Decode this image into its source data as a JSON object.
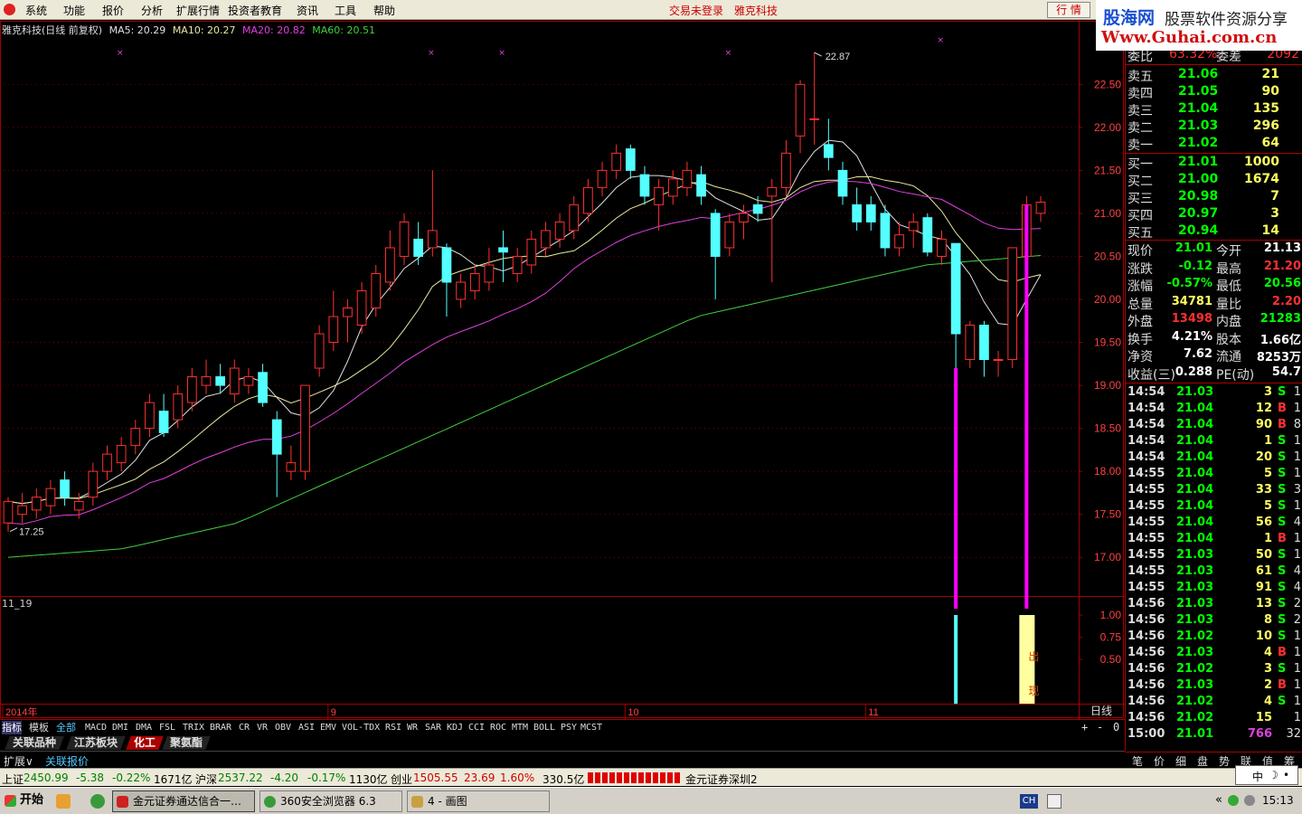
{
  "menubar": {
    "items": [
      "系统",
      "功能",
      "报价",
      "分析",
      "扩展行情",
      "投资者教育",
      "资讯",
      "工具",
      "帮助"
    ],
    "not_logged": "交易未登录",
    "stock_name": "雅克科技",
    "hq_button": "行 情"
  },
  "watermark": {
    "site_cn": "股海网",
    "slogan": "股票软件资源分享",
    "url": "Www.Guhai.com.cn"
  },
  "chart": {
    "title": "雅克科技(日线 前复权)",
    "ma_legend": [
      {
        "label": "MA5: 20.29",
        "color": "#e0e0e0"
      },
      {
        "label": "MA10: 20.27",
        "color": "#e8e8a0"
      },
      {
        "label": "MA20: 20.82",
        "color": "#e040e0"
      },
      {
        "label": "MA60: 20.51",
        "color": "#40d040"
      }
    ],
    "high_label": "22.87",
    "low_label": "17.25",
    "indicator_name": "11_19",
    "signal_text": [
      "出",
      "现"
    ],
    "period": "日线",
    "colors": {
      "up": "#ff3030",
      "down": "#54ffff",
      "ma5": "#e0e0e0",
      "ma10": "#e8e8a0",
      "ma20": "#e040e0",
      "ma60": "#40d040",
      "signal": "#ff00ff",
      "grid": "#a00000",
      "highlight": "#ffffa0"
    }
  },
  "chart_data": {
    "type": "candlestick",
    "price_axis": [
      "22.50",
      "22.00",
      "21.50",
      "21.00",
      "20.50",
      "20.00",
      "19.50",
      "19.00",
      "18.50",
      "18.00",
      "17.50",
      "17.00"
    ],
    "ind_axis": [
      "1.00",
      "0.75",
      "0.50"
    ],
    "date_axis": [
      {
        "label": "2014年",
        "i": 0
      },
      {
        "label": "9",
        "i": 23
      },
      {
        "label": "10",
        "i": 44
      },
      {
        "label": "11",
        "i": 61
      }
    ],
    "candles": [
      [
        17.4,
        17.65,
        17.3,
        17.7
      ],
      [
        17.5,
        17.6,
        17.4,
        17.75
      ],
      [
        17.55,
        17.7,
        17.45,
        17.8
      ],
      [
        17.6,
        17.8,
        17.5,
        17.9
      ],
      [
        17.9,
        17.7,
        17.6,
        18.0
      ],
      [
        17.55,
        17.65,
        17.45,
        17.75
      ],
      [
        17.7,
        18.0,
        17.6,
        18.1
      ],
      [
        18.0,
        18.2,
        17.9,
        18.3
      ],
      [
        18.1,
        18.3,
        18.0,
        18.4
      ],
      [
        18.3,
        18.5,
        18.2,
        18.6
      ],
      [
        18.5,
        18.8,
        18.4,
        18.9
      ],
      [
        18.7,
        18.45,
        18.4,
        18.9
      ],
      [
        18.6,
        18.9,
        18.5,
        19.0
      ],
      [
        18.8,
        19.1,
        18.7,
        19.2
      ],
      [
        19.0,
        19.1,
        18.9,
        19.3
      ],
      [
        19.1,
        19.0,
        18.9,
        19.25
      ],
      [
        18.9,
        19.2,
        18.8,
        19.3
      ],
      [
        19.0,
        19.1,
        18.9,
        19.2
      ],
      [
        19.15,
        18.8,
        18.75,
        19.25
      ],
      [
        18.6,
        18.2,
        17.7,
        18.7
      ],
      [
        18.0,
        18.1,
        17.9,
        18.3
      ],
      [
        18.0,
        19.0,
        17.9,
        19.0
      ],
      [
        19.2,
        19.6,
        19.1,
        19.7
      ],
      [
        19.5,
        19.8,
        19.4,
        20.1
      ],
      [
        19.8,
        19.9,
        19.5,
        20.0
      ],
      [
        19.7,
        20.1,
        19.6,
        20.2
      ],
      [
        19.9,
        20.3,
        19.8,
        20.4
      ],
      [
        20.2,
        20.6,
        20.1,
        20.8
      ],
      [
        20.5,
        20.9,
        20.4,
        21.0
      ],
      [
        20.7,
        20.5,
        20.4,
        20.9
      ],
      [
        20.6,
        20.8,
        20.5,
        21.5
      ],
      [
        20.6,
        20.2,
        19.8,
        20.65
      ],
      [
        20.0,
        20.2,
        19.9,
        20.3
      ],
      [
        20.1,
        20.3,
        20.0,
        20.4
      ],
      [
        20.2,
        20.4,
        20.1,
        20.6
      ],
      [
        20.6,
        20.55,
        20.2,
        20.8
      ],
      [
        20.3,
        20.5,
        20.2,
        20.6
      ],
      [
        20.4,
        20.7,
        20.3,
        20.8
      ],
      [
        20.6,
        20.8,
        20.5,
        20.9
      ],
      [
        20.7,
        20.9,
        20.6,
        21.0
      ],
      [
        20.8,
        21.1,
        20.7,
        21.2
      ],
      [
        21.0,
        21.3,
        20.9,
        21.4
      ],
      [
        21.3,
        21.5,
        21.2,
        21.6
      ],
      [
        21.5,
        21.7,
        21.4,
        21.8
      ],
      [
        21.75,
        21.5,
        21.4,
        21.8
      ],
      [
        21.45,
        21.2,
        21.1,
        21.55
      ],
      [
        21.1,
        21.3,
        20.8,
        21.4
      ],
      [
        21.2,
        21.4,
        21.1,
        21.5
      ],
      [
        21.3,
        21.5,
        21.2,
        21.6
      ],
      [
        21.45,
        21.2,
        21.1,
        21.55
      ],
      [
        21.0,
        20.5,
        20.0,
        21.05
      ],
      [
        20.6,
        20.9,
        20.5,
        21.0
      ],
      [
        20.9,
        21.0,
        20.7,
        21.1
      ],
      [
        21.1,
        21.0,
        20.9,
        21.2
      ],
      [
        21.2,
        21.3,
        20.2,
        21.4
      ],
      [
        21.3,
        21.7,
        21.2,
        21.85
      ],
      [
        21.9,
        22.5,
        21.7,
        22.55
      ],
      [
        22.1,
        22.1,
        21.8,
        22.87
      ],
      [
        21.8,
        21.65,
        21.5,
        22.1
      ],
      [
        21.5,
        21.2,
        21.1,
        21.6
      ],
      [
        21.1,
        20.9,
        20.8,
        21.3
      ],
      [
        21.1,
        20.9,
        20.8,
        21.2
      ],
      [
        21.0,
        20.6,
        20.5,
        21.1
      ],
      [
        20.6,
        20.75,
        20.5,
        20.9
      ],
      [
        20.8,
        20.9,
        20.6,
        21.0
      ],
      [
        20.95,
        20.55,
        20.5,
        21.0
      ],
      [
        20.5,
        20.7,
        20.4,
        20.8
      ],
      [
        20.65,
        19.6,
        19.2,
        20.65
      ],
      [
        19.3,
        19.7,
        19.2,
        19.75
      ],
      [
        19.7,
        19.3,
        19.1,
        19.75
      ],
      [
        19.3,
        19.3,
        19.1,
        19.4
      ],
      [
        19.3,
        20.6,
        19.2,
        20.6
      ],
      [
        20.5,
        21.1,
        20.4,
        21.2
      ],
      [
        21.0,
        21.13,
        20.9,
        21.2
      ]
    ],
    "ma60": [
      17.0,
      17.1,
      17.4,
      18.0,
      18.6,
      19.2,
      19.8,
      20.1,
      20.4,
      20.51
    ],
    "signals": [
      {
        "i": 67,
        "value": 1.0
      },
      {
        "i": 72,
        "value": 1.0
      }
    ]
  },
  "order_book": {
    "weibi": {
      "label": "委比",
      "value": "63.32%",
      "diff_label": "委差",
      "diff_value": "2092"
    },
    "sell": [
      {
        "label": "卖五",
        "price": "21.06",
        "vol": "21"
      },
      {
        "label": "卖四",
        "price": "21.05",
        "vol": "90"
      },
      {
        "label": "卖三",
        "price": "21.04",
        "vol": "135"
      },
      {
        "label": "卖二",
        "price": "21.03",
        "vol": "296"
      },
      {
        "label": "卖一",
        "price": "21.02",
        "vol": "64"
      }
    ],
    "buy": [
      {
        "label": "买一",
        "price": "21.01",
        "vol": "1000"
      },
      {
        "label": "买二",
        "price": "21.00",
        "vol": "1674"
      },
      {
        "label": "买三",
        "price": "20.98",
        "vol": "7"
      },
      {
        "label": "买四",
        "price": "20.97",
        "vol": "3"
      },
      {
        "label": "买五",
        "price": "20.94",
        "vol": "14"
      }
    ]
  },
  "quote": [
    {
      "l1": "现价",
      "v1": "21.01",
      "c1": "#00ff00",
      "l2": "今开",
      "v2": "21.13",
      "c2": "#ffffff"
    },
    {
      "l1": "涨跌",
      "v1": "-0.12",
      "c1": "#00ff00",
      "l2": "最高",
      "v2": "21.20",
      "c2": "#ff3030"
    },
    {
      "l1": "涨幅",
      "v1": "-0.57%",
      "c1": "#00ff00",
      "l2": "最低",
      "v2": "20.56",
      "c2": "#00ff00"
    },
    {
      "l1": "总量",
      "v1": "34781",
      "c1": "#ffff60",
      "l2": "量比",
      "v2": "2.20",
      "c2": "#ff3030"
    },
    {
      "l1": "外盘",
      "v1": "13498",
      "c1": "#ff3030",
      "l2": "内盘",
      "v2": "21283",
      "c2": "#00ff00"
    },
    {
      "l1": "换手",
      "v1": "4.21%",
      "c1": "#ffffff",
      "l2": "股本",
      "v2": "1.66亿",
      "c2": "#ffffff"
    },
    {
      "l1": "净资",
      "v1": "7.62",
      "c1": "#ffffff",
      "l2": "流通",
      "v2": "8253万",
      "c2": "#ffffff"
    },
    {
      "l1": "收益(三)",
      "v1": "0.288",
      "c1": "#ffffff",
      "l2": "PE(动)",
      "v2": "54.7",
      "c2": "#ffffff"
    }
  ],
  "ticks": [
    {
      "t": "14:54",
      "p": "21.03",
      "v": "3",
      "bs": "S",
      "n": "1"
    },
    {
      "t": "14:54",
      "p": "21.04",
      "v": "12",
      "bs": "B",
      "n": "1"
    },
    {
      "t": "14:54",
      "p": "21.04",
      "v": "90",
      "bs": "B",
      "n": "8"
    },
    {
      "t": "14:54",
      "p": "21.04",
      "v": "1",
      "bs": "S",
      "n": "1"
    },
    {
      "t": "14:54",
      "p": "21.04",
      "v": "20",
      "bs": "S",
      "n": "1"
    },
    {
      "t": "14:55",
      "p": "21.04",
      "v": "5",
      "bs": "S",
      "n": "1"
    },
    {
      "t": "14:55",
      "p": "21.04",
      "v": "33",
      "bs": "S",
      "n": "3"
    },
    {
      "t": "14:55",
      "p": "21.04",
      "v": "5",
      "bs": "S",
      "n": "1"
    },
    {
      "t": "14:55",
      "p": "21.04",
      "v": "56",
      "bs": "S",
      "n": "4"
    },
    {
      "t": "14:55",
      "p": "21.04",
      "v": "1",
      "bs": "B",
      "n": "1"
    },
    {
      "t": "14:55",
      "p": "21.03",
      "v": "50",
      "bs": "S",
      "n": "1"
    },
    {
      "t": "14:55",
      "p": "21.03",
      "v": "61",
      "bs": "S",
      "n": "4"
    },
    {
      "t": "14:55",
      "p": "21.03",
      "v": "91",
      "bs": "S",
      "n": "4"
    },
    {
      "t": "14:56",
      "p": "21.03",
      "v": "13",
      "bs": "S",
      "n": "2"
    },
    {
      "t": "14:56",
      "p": "21.03",
      "v": "8",
      "bs": "S",
      "n": "2"
    },
    {
      "t": "14:56",
      "p": "21.02",
      "v": "10",
      "bs": "S",
      "n": "1"
    },
    {
      "t": "14:56",
      "p": "21.03",
      "v": "4",
      "bs": "B",
      "n": "1"
    },
    {
      "t": "14:56",
      "p": "21.02",
      "v": "3",
      "bs": "S",
      "n": "1"
    },
    {
      "t": "14:56",
      "p": "21.03",
      "v": "2",
      "bs": "B",
      "n": "1"
    },
    {
      "t": "14:56",
      "p": "21.02",
      "v": "4",
      "bs": "S",
      "n": "1"
    },
    {
      "t": "14:56",
      "p": "21.02",
      "v": "15",
      "bs": "",
      "n": "1"
    },
    {
      "t": "15:00",
      "p": "21.01",
      "v": "766",
      "bs": "",
      "n": "32"
    }
  ],
  "right_tabs": [
    "笔",
    "价",
    "细",
    "盘",
    "势",
    "联",
    "值",
    "筹"
  ],
  "indicator_tabs": [
    "指标",
    "模板",
    "全部",
    "MACD",
    "DMI",
    "DMA",
    "FSL",
    "TRIX",
    "BRAR",
    "CR",
    "VR",
    "OBV",
    "ASI",
    "EMV",
    "VOL-TDX",
    "RSI",
    "WR",
    "SAR",
    "KDJ",
    "CCI",
    "ROC",
    "MTM",
    "BOLL",
    "PSY",
    "MCST"
  ],
  "controls": {
    "plus": "+",
    "minus": "-",
    "zero": "0"
  },
  "block_tabs": [
    "关联品种",
    "江苏板块",
    "化工",
    "聚氨酯"
  ],
  "expand_row": {
    "expand": "扩展∨",
    "related": "关联报价"
  },
  "indexbar": {
    "sh_label": "上证",
    "sh_val": "2450.99",
    "sh_chg": "-5.38",
    "sh_pct": "-0.22%",
    "sh_amt": "1671亿",
    "hs_label": "沪深",
    "hs_val": "2537.22",
    "hs_chg": "-4.20",
    "hs_pct": "-0.17%",
    "hs_amt": "1130亿",
    "cy_label": "创业",
    "cy_val": "1505.55",
    "cy_chg": "23.69",
    "cy_pct": "1.60%",
    "cy_amt": "330.5亿",
    "server": "金元证券深圳2"
  },
  "ime": "中",
  "taskbar": {
    "start": "开始",
    "windows": [
      "金元证券通达信合一…",
      "360安全浏览器 6.3",
      "4 - 画图"
    ],
    "tray_ch": "CH",
    "clock": "15:13"
  }
}
